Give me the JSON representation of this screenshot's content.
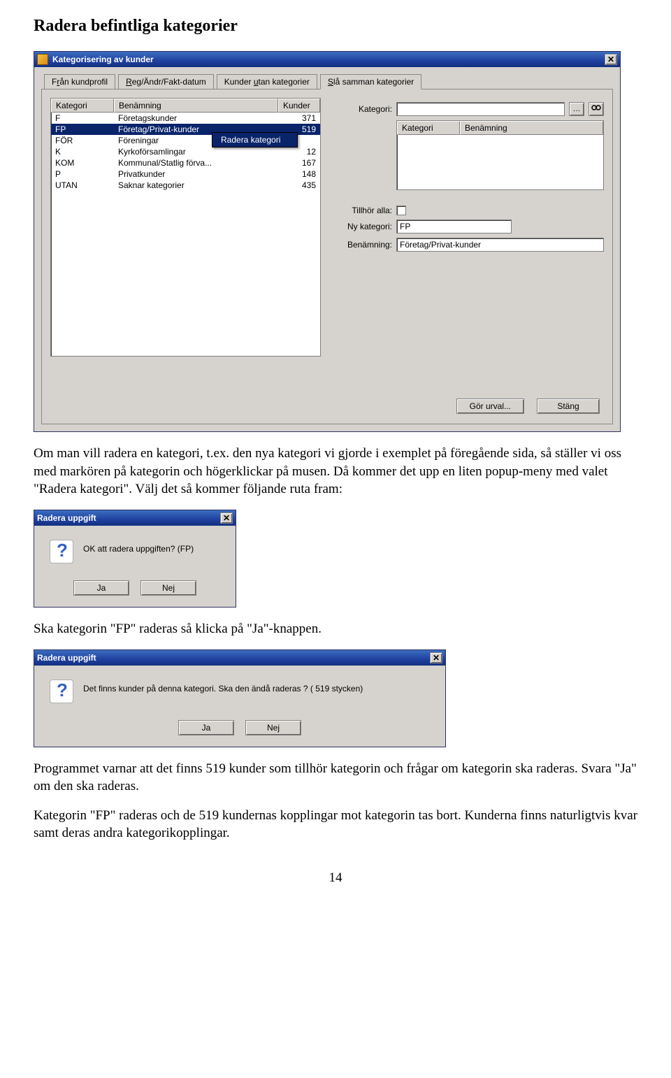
{
  "doc": {
    "heading": "Radera befintliga kategorier",
    "para1": "Om man vill radera en kategori, t.ex. den nya kategori vi gjorde i exemplet på föregående sida, så ställer vi oss med markören på kategorin och högerklickar på musen. Då kommer det upp en liten popup-meny med valet \"Radera kategori\". Välj det så kommer följande ruta fram:",
    "para2": "Ska kategorin \"FP\" raderas så klicka på \"Ja\"-knappen.",
    "para3": "Programmet varnar att det finns 519 kunder som tillhör kategorin och frågar om kategorin ska raderas. Svara \"Ja\" om den ska raderas.",
    "para4": "Kategorin \"FP\" raderas och de 519 kundernas kopplingar mot kategorin tas bort. Kunderna finns naturligtvis kvar samt deras andra kategorikopplingar.",
    "page_number": "14"
  },
  "main_window": {
    "title": "Kategorisering av kunder",
    "tabs": [
      {
        "label_pre": "F",
        "ul": "r",
        "label_post": "ån kundprofil"
      },
      {
        "label_pre": "",
        "ul": "R",
        "label_post": "eg/Ändr/Fakt-datum"
      },
      {
        "label_pre": "Kunder ",
        "ul": "u",
        "label_post": "tan kategorier"
      },
      {
        "label_pre": "",
        "ul": "S",
        "label_post": "lå samman kategorier"
      }
    ],
    "list_headers": {
      "c1": "Kategori",
      "c2": "Benämning",
      "c3": "Kunder"
    },
    "list_rows": [
      {
        "c1": "F",
        "c2": "Företagskunder",
        "c3": "371"
      },
      {
        "c1": "FP",
        "c2": "Företag/Privat-kunder",
        "c3": "519",
        "selected": true
      },
      {
        "c1": "FÖR",
        "c2": "Föreningar",
        "c3": ""
      },
      {
        "c1": "K",
        "c2": "Kyrkoförsamlingar",
        "c3": "12"
      },
      {
        "c1": "KOM",
        "c2": "Kommunal/Statlig förva...",
        "c3": "167"
      },
      {
        "c1": "P",
        "c2": "Privatkunder",
        "c3": "148"
      },
      {
        "c1": "UTAN",
        "c2": "Saknar kategorier",
        "c3": "435"
      }
    ],
    "context_menu_item": "Radera kategori",
    "right_labels": {
      "kategori": "Kategori:",
      "tillhor_alla": "Tillhör alla:",
      "ny_kategori": "Ny kategori:",
      "benamning": "Benämning:"
    },
    "right_headers": {
      "c1": "Kategori",
      "c2": "Benämning"
    },
    "right_values": {
      "ny_kategori": "FP",
      "benamning": "Företag/Privat-kunder"
    },
    "button_gor_urval": "Gör urval...",
    "button_stang": "Stäng"
  },
  "dialog1": {
    "title": "Radera uppgift",
    "text": "OK att radera uppgiften? (FP)",
    "yes": "Ja",
    "no": "Nej"
  },
  "dialog2": {
    "title": "Radera uppgift",
    "text": "Det finns kunder på denna kategori. Ska den ändå raderas ? ( 519 stycken)",
    "yes": "Ja",
    "no": "Nej"
  }
}
